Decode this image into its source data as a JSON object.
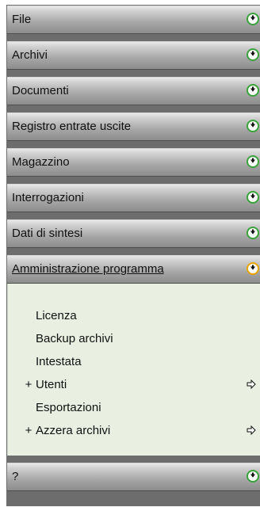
{
  "menu": {
    "sections": [
      {
        "label": "File"
      },
      {
        "label": "Archivi"
      },
      {
        "label": "Documenti"
      },
      {
        "label": "Registro entrate uscite"
      },
      {
        "label": "Magazzino"
      },
      {
        "label": "Interrogazioni"
      },
      {
        "label": "Dati di sintesi"
      },
      {
        "label": "Amministrazione programma"
      },
      {
        "label": "?"
      }
    ],
    "expanded_items": [
      {
        "label": "Licenza"
      },
      {
        "label": "Backup archivi"
      },
      {
        "label": "Intestata"
      },
      {
        "label": "Utenti",
        "prefix": "+"
      },
      {
        "label": "Esportazioni"
      },
      {
        "label": "Azzera archivi",
        "prefix": "+"
      }
    ]
  },
  "icons": {
    "collapsed_toggle": "expand-down-icon",
    "expanded_toggle": "expanded-down-icon",
    "submenu_arrow": "right-arrow-icon"
  },
  "colors": {
    "toggle_green": "#3aa23a",
    "toggle_orange": "#e8a400",
    "panel_bg": "#e9f0e2"
  }
}
